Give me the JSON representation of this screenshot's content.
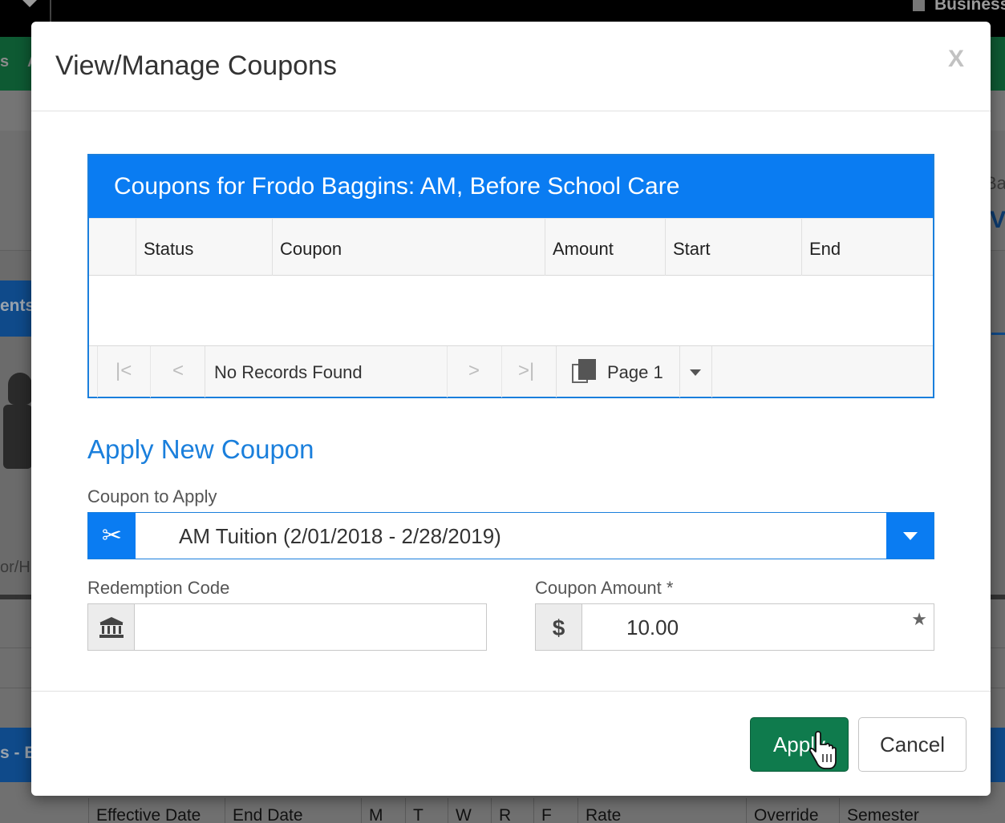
{
  "background": {
    "top_right_label": "Business",
    "side_tab_fragment": "ents",
    "side_text_fragment": "or/H",
    "right_fragment_1": "Ba",
    "right_fragment_2": "V",
    "green_nav_fragments": [
      "s",
      "A"
    ],
    "blue_bar_fragment": "s - B",
    "table_headers": [
      "Effective Date",
      "End Date",
      "M",
      "T",
      "W",
      "R",
      "F",
      "Rate",
      "Override",
      "Semester"
    ]
  },
  "modal": {
    "title": "View/Manage Coupons",
    "close_label": "X",
    "grid": {
      "caption": "Coupons for Frodo Baggins: AM, Before School Care",
      "columns": [
        "",
        "Status",
        "Coupon",
        "Amount",
        "Start",
        "End"
      ],
      "rows": [],
      "pager": {
        "first": "|<",
        "prev": "<",
        "status_text": "No Records Found",
        "next": ">",
        "last": ">|",
        "page_label": "Page 1"
      }
    },
    "apply_section": {
      "title": "Apply New Coupon",
      "coupon_label": "Coupon to Apply",
      "coupon_value": "AM Tuition (2/01/2018 - 2/28/2019)",
      "redemption_label": "Redemption Code",
      "redemption_value": "",
      "amount_label": "Coupon Amount *",
      "amount_prefix": "$",
      "amount_value": "10.00"
    },
    "footer": {
      "apply_label": "Apply",
      "cancel_label": "Cancel"
    }
  },
  "colors": {
    "primary_blue": "#0a7cf2",
    "apply_green": "#0f7b4d",
    "section_title_blue": "#1a7fdc"
  },
  "icons": [
    "chevron-down-icon",
    "building-icon",
    "scissors-icon",
    "bank-icon",
    "dollar-icon",
    "star-icon",
    "pages-icon",
    "hand-cursor-icon"
  ]
}
